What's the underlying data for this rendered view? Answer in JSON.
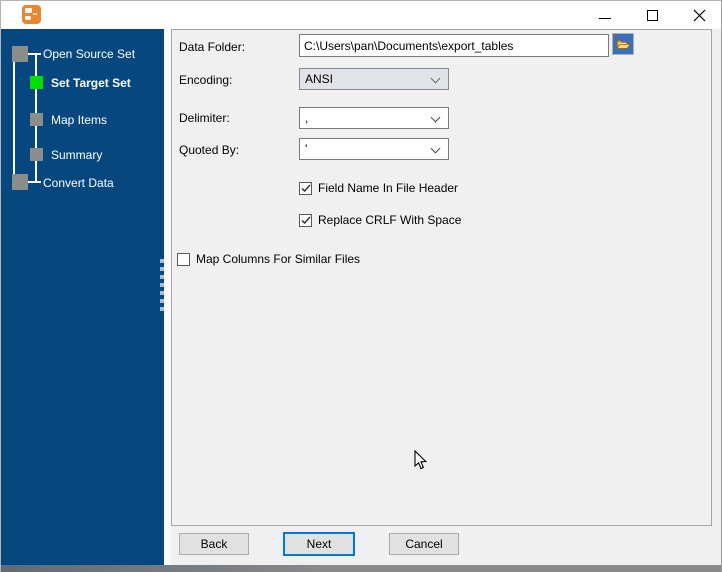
{
  "window": {
    "title": "",
    "controls": {
      "minimize": "minimize",
      "maximize": "maximize",
      "close": "close"
    }
  },
  "sidebar": {
    "steps": [
      {
        "label": "Open Source Set",
        "level": 1,
        "state": "done"
      },
      {
        "label": "Set Target Set",
        "level": 2,
        "state": "active"
      },
      {
        "label": "Map Items",
        "level": 2,
        "state": "pending"
      },
      {
        "label": "Summary",
        "level": 2,
        "state": "pending"
      },
      {
        "label": "Convert Data",
        "level": 1,
        "state": "pending"
      }
    ]
  },
  "form": {
    "data_folder": {
      "label": "Data Folder:",
      "value": "C:\\Users\\pan\\Documents\\export_tables"
    },
    "encoding": {
      "label": "Encoding:",
      "value": "ANSI"
    },
    "delimiter": {
      "label": "Delimiter:",
      "value": ","
    },
    "quoted_by": {
      "label": "Quoted By:",
      "value": "'"
    },
    "checkboxes": [
      {
        "label": "Field Name In File Header",
        "checked": true
      },
      {
        "label": "Replace CRLF With Space",
        "checked": true
      },
      {
        "label": "Map Columns For Similar Files",
        "checked": false
      }
    ]
  },
  "footer": {
    "back": "Back",
    "next": "Next",
    "cancel": "Cancel"
  },
  "colors": {
    "sidebar_bg": "#05477E",
    "active_step_square": "#00DF00",
    "inactive_step_square": "#8C8C8C",
    "default_button_border": "#0078D7",
    "browse_button_bg": "#3A70B9",
    "folder_icon": "#FFD766",
    "app_icon_bg": "#E8872E",
    "bottom_strip": "#898989"
  }
}
